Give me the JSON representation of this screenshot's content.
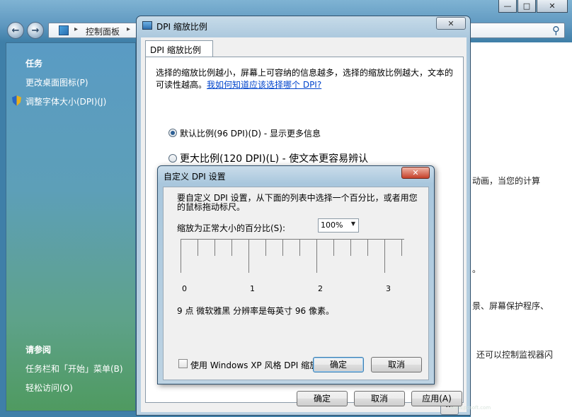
{
  "control_panel": {
    "address": {
      "breadcrumb": "控制面板",
      "search_icon": "search-icon"
    },
    "sidebar": {
      "tasks_heading": "任务",
      "tasks": [
        {
          "label": "更改桌面图标(P)"
        },
        {
          "label": "调整字体大小(DPI)(J)",
          "icon": "shield-icon"
        }
      ],
      "see_also_heading": "请参阅",
      "see_also": [
        {
          "label": "任务栏和「开始」菜单(B)"
        },
        {
          "label": "轻松访问(O)"
        }
      ]
    },
    "content_fragments": [
      "动画，当您的计算",
      "。",
      "景、屏幕保护程序、",
      "还可以控制监视器闪"
    ]
  },
  "dpi_dialog": {
    "title": "DPI 缩放比例",
    "tab_label": "DPI 缩放比例",
    "description": "选择的缩放比例越小，屏幕上可容纳的信息越多，选择的缩放比例越大，文本的可读性越高。",
    "help_link": "我如何知道应该选择哪个 DPI?",
    "options": [
      {
        "label": "默认比例(96 DPI)(D) - 显示更多信息",
        "selected": true
      },
      {
        "label": "更大比例(120 DPI)(L) - 使文本更容易辨认",
        "selected": false
      }
    ],
    "custom_button": "...",
    "buttons": {
      "ok": "确定",
      "cancel": "取消",
      "apply": "应用(A)"
    }
  },
  "custom_dialog": {
    "title": "自定义 DPI 设置",
    "description": "要自定义 DPI 设置，从下面的列表中选择一个百分比，或者用您的鼠标拖动标尺。",
    "scale_label": "缩放为正常大小的百分比(S):",
    "scale_value": "100%",
    "ruler_labels": [
      "0",
      "1",
      "2",
      "3"
    ],
    "info": "9 点 微软雅黑 分辨率是每英寸 96 像素。",
    "xp_checkbox_label": "使用 Windows XP 风格 DPI 缩放比例(X)",
    "xp_checked": false,
    "buttons": {
      "ok": "确定",
      "cancel": "取消"
    }
  },
  "watermark": "www.pcsoft.com"
}
